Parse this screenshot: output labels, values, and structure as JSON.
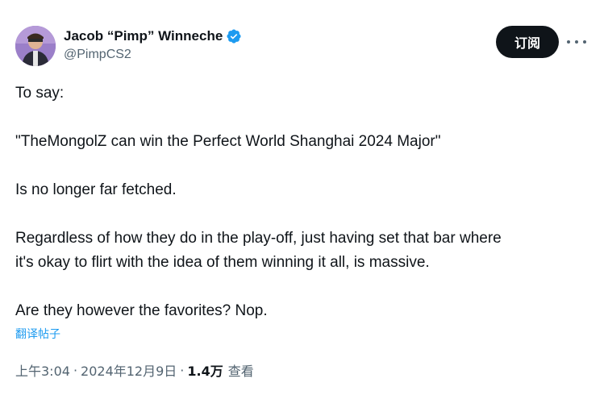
{
  "author": {
    "display_name": "Jacob “Pimp” Winneche",
    "handle": "@PimpCS2",
    "verified": true
  },
  "subscribe_label": "订阅",
  "tweet": {
    "lines": [
      "To say:",
      "\"TheMongolZ can win the Perfect World Shanghai 2024 Major\"",
      "Is no longer far fetched.",
      "Regardless of how they do in the play-off, just having set that bar where",
      "it's okay to flirt with the idea of them winning it all, is massive.",
      "Are they however the favorites? Nop."
    ]
  },
  "translate_label": "翻译帖子",
  "meta": {
    "time": "上午3:04",
    "date": "2024年12月9日",
    "views_count": "1.4万",
    "views_label": "查看",
    "separator": "·"
  },
  "colors": {
    "text": "#0f1419",
    "secondary": "#536471",
    "accent": "#1d9bf0",
    "button_bg": "#0f1419"
  },
  "icons": {
    "verified": "verified-badge-icon",
    "more": "more-horizontal-icon"
  }
}
